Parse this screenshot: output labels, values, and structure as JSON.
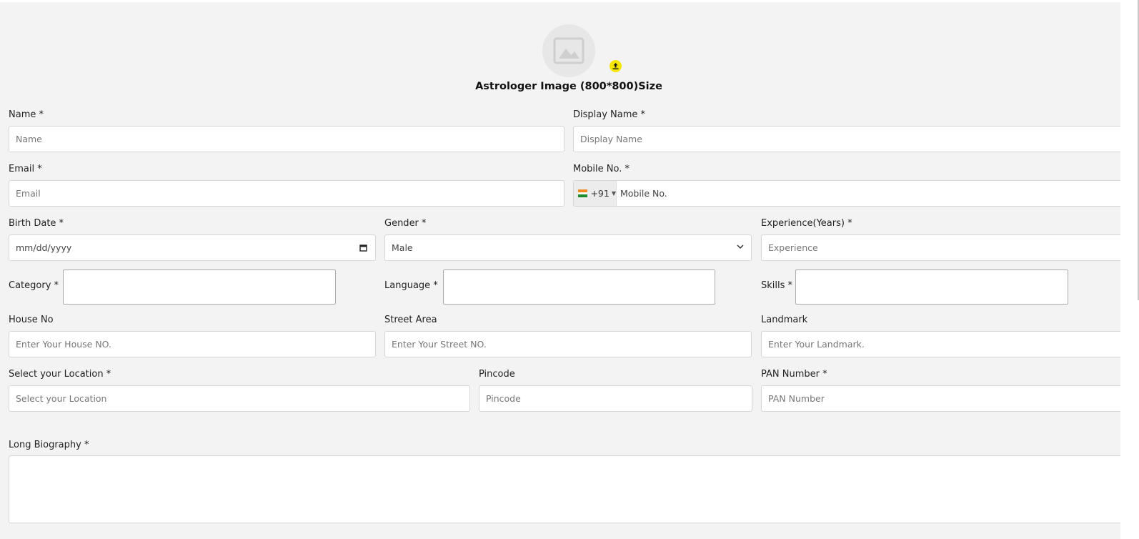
{
  "image": {
    "caption": "Astrologer Image (800*800)Size",
    "placeholder_icon": "image-placeholder-icon",
    "upload_icon": "upload-icon",
    "upload_color": "#f5e600"
  },
  "fields": {
    "name": {
      "label": "Name *",
      "placeholder": "Name"
    },
    "display_name": {
      "label": "Display Name *",
      "placeholder": "Display Name"
    },
    "email": {
      "label": "Email *",
      "placeholder": "Email"
    },
    "mobile": {
      "label": "Mobile No. *",
      "placeholder": "Mobile No.",
      "country_code": "+91",
      "flag_icon": "india-flag-icon"
    },
    "birth_date": {
      "label": "Birth Date *",
      "value": "mm/dd/yyyy"
    },
    "gender": {
      "label": "Gender *",
      "value": "Male"
    },
    "experience": {
      "label": "Experience(Years) *",
      "placeholder": "Experience"
    },
    "category": {
      "label": "Category *"
    },
    "language": {
      "label": "Language *"
    },
    "skills": {
      "label": "Skills *"
    },
    "house_no": {
      "label": "House No",
      "placeholder": "Enter Your House NO."
    },
    "street_area": {
      "label": "Street Area",
      "placeholder": "Enter Your Street NO."
    },
    "landmark": {
      "label": "Landmark",
      "placeholder": "Enter Your Landmark."
    },
    "location": {
      "label": "Select your Location *",
      "placeholder": "Select your Location"
    },
    "pincode": {
      "label": "Pincode",
      "placeholder": "Pincode"
    },
    "pan": {
      "label": "PAN Number *",
      "placeholder": "PAN Number"
    },
    "biography": {
      "label": "Long Biography *"
    }
  },
  "colors": {
    "page_bg": "#f3f3f3",
    "input_border": "#d6d6d6"
  }
}
